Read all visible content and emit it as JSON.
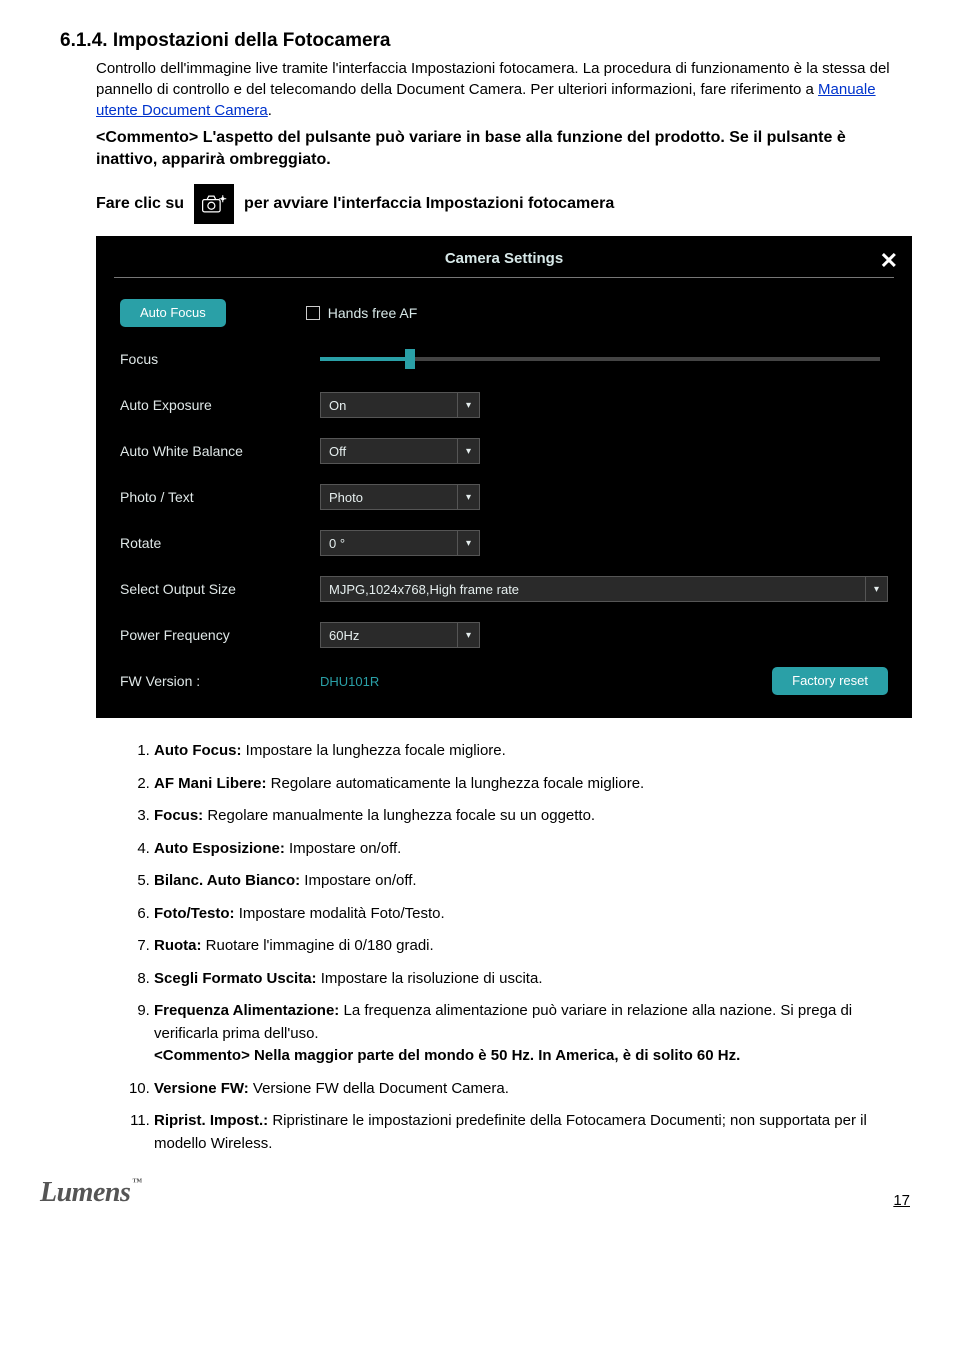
{
  "heading": "6.1.4. Impostazioni della Fotocamera",
  "intro": {
    "p1": "Controllo dell'immagine live tramite l'interfaccia Impostazioni fotocamera. La procedura di funzionamento è la stessa del pannello di controllo e del telecomando della Document Camera. Per ulteriori informazioni, fare riferimento a ",
    "link": "Manuale utente Document Camera",
    "p1_end": "."
  },
  "comment": "<Commento> L'aspetto del pulsante può variare in base alla funzione del prodotto. Se il pulsante è inattivo, apparirà ombreggiato.",
  "click_pre": "Fare clic su",
  "click_post": " per avviare l'interfaccia Impostazioni fotocamera",
  "panel": {
    "title": "Camera Settings",
    "auto_focus_btn": "Auto Focus",
    "hands_free": "Hands free AF",
    "labels": {
      "focus": "Focus",
      "auto_exposure": "Auto Exposure",
      "auto_wb": "Auto White Balance",
      "photo_text": "Photo / Text",
      "rotate": "Rotate",
      "output_size": "Select Output Size",
      "power_freq": "Power Frequency",
      "fw": "FW Version :"
    },
    "values": {
      "auto_exposure": "On",
      "auto_wb": "Off",
      "photo_text": "Photo",
      "rotate": "0 °",
      "output_size": "MJPG,1024x768,High frame rate",
      "power_freq": "60Hz",
      "fw": "DHU101R"
    },
    "factory_reset": "Factory reset"
  },
  "list": [
    {
      "b": "Auto Focus:",
      "t": " Impostare la lunghezza focale migliore."
    },
    {
      "b": "AF Mani Libere:",
      "t": " Regolare automaticamente la lunghezza focale migliore."
    },
    {
      "b": "Focus:",
      "t": " Regolare manualmente la lunghezza focale su un oggetto."
    },
    {
      "b": "Auto Esposizione:",
      "t": " Impostare on/off."
    },
    {
      "b": "Bilanc. Auto Bianco:",
      "t": " Impostare on/off."
    },
    {
      "b": "Foto/Testo:",
      "t": " Impostare modalità Foto/Testo."
    },
    {
      "b": "Ruota:",
      "t": " Ruotare l'immagine di 0/180 gradi."
    },
    {
      "b": "Scegli Formato Uscita:",
      "t": " Impostare la risoluzione di uscita."
    },
    {
      "b": "Frequenza Alimentazione:",
      "t": " La frequenza alimentazione può variare in relazione alla nazione. Si prega di verificarla prima dell'uso.",
      "extra": "<Commento> Nella maggior parte del mondo è 50 Hz. In America, è di solito 60 Hz."
    },
    {
      "b": "Versione FW:",
      "t": " Versione FW della Document Camera."
    },
    {
      "b": "Riprist. Impost.:",
      "t": " Ripristinare le impostazioni predefinite della Fotocamera Documenti; non supportata per il modello Wireless."
    }
  ],
  "footer": {
    "logo": "Lumens",
    "tm": "™",
    "page": "17"
  },
  "chart_data": {
    "type": "table",
    "title": "Camera Settings panel state",
    "rows": [
      [
        "Auto Exposure",
        "On"
      ],
      [
        "Auto White Balance",
        "Off"
      ],
      [
        "Photo / Text",
        "Photo"
      ],
      [
        "Rotate",
        "0 °"
      ],
      [
        "Select Output Size",
        "MJPG,1024x768,High frame rate"
      ],
      [
        "Power Frequency",
        "60Hz"
      ],
      [
        "FW Version",
        "DHU101R"
      ]
    ]
  }
}
